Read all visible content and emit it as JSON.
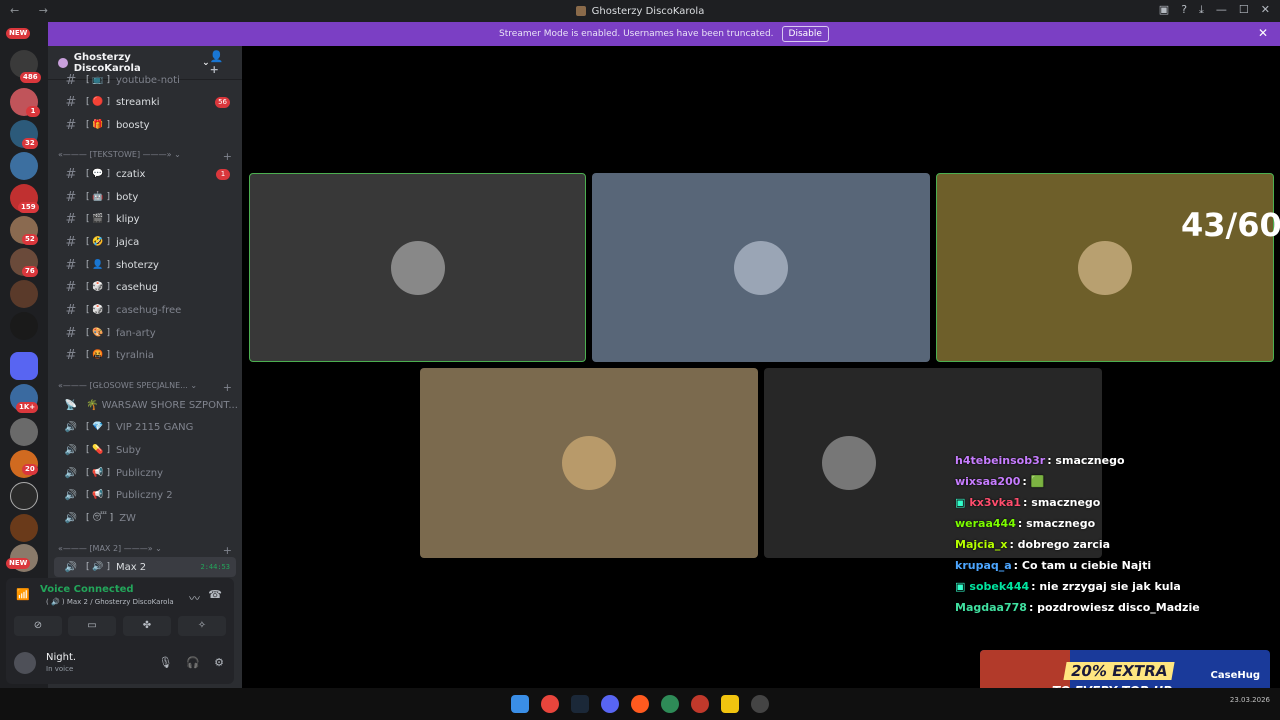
{
  "window": {
    "title": "Ghosterzy DiscoKarola"
  },
  "banner": {
    "text": "Streamer Mode is enabled. Usernames have been truncated.",
    "button": "Disable"
  },
  "guilds": {
    "new_top": "NEW",
    "new_bottom": "NEW",
    "badges": [
      "486",
      "1",
      "32",
      "159",
      "52",
      "76",
      "1K+",
      "20"
    ]
  },
  "server": {
    "name": "Ghosterzy DiscoKarola"
  },
  "channels": {
    "top": [
      {
        "name": "youtube-noti",
        "emoji": "[ 📺 ]"
      },
      {
        "name": "streamki",
        "emoji": "[ 🔴 ]",
        "badge": "56"
      },
      {
        "name": "boosty",
        "emoji": "[ 🎁 ]"
      }
    ],
    "cat_text": "«——— [TEKSTOWE] ———» ⌄",
    "text": [
      {
        "name": "czatix",
        "emoji": "[ 💬 ]",
        "badge": "1"
      },
      {
        "name": "boty",
        "emoji": "[ 🤖 ]"
      },
      {
        "name": "klipy",
        "emoji": "[ 🎬 ]"
      },
      {
        "name": "jajca",
        "emoji": "[ 🤣 ]"
      },
      {
        "name": "shoterzy",
        "emoji": "[ 👤 ]"
      },
      {
        "name": "casehug",
        "emoji": "[ 🎲 ]"
      },
      {
        "name": "casehug-free",
        "emoji": "[ 🎲 ]"
      },
      {
        "name": "fan-arty",
        "emoji": "[ 🎨 ]"
      },
      {
        "name": "tyralnia",
        "emoji": "[ 🤬 ]"
      }
    ],
    "cat_voice": "«——— [GŁOSOWE SPECJALNE... ⌄",
    "voice": [
      {
        "name": "🌴 WARSAW SHORE SZPONT...",
        "emoji": ""
      },
      {
        "name": "VIP 2115 GANG",
        "emoji": "[ 💎 ]"
      },
      {
        "name": "Suby",
        "emoji": "[ 💊 ]"
      },
      {
        "name": "Publiczny",
        "emoji": "[ 📢 ]"
      },
      {
        "name": "Publiczny 2",
        "emoji": "[ 📢 ]"
      },
      {
        "name": "ZW",
        "emoji": "[ 😴 ]"
      }
    ],
    "cat_max": "«——— [MAX 2] ———» ⌄",
    "active": {
      "name": "Max 2",
      "emoji": "[ 🔊 ]",
      "timer": "2:44:53"
    }
  },
  "voice": {
    "status": "Voice Connected",
    "sub": "( 🔊 ) Max 2 / Ghosterzy DiscoKarola"
  },
  "user": {
    "name": "Night.",
    "status": "In voice"
  },
  "counter": "43/60",
  "chat": [
    {
      "user": "h4tebeinsob3r",
      "color": "#c77dff",
      "msg": ": smacznego"
    },
    {
      "user": "wixsaa200",
      "color": "#c77dff",
      "msg": ": 🟩"
    },
    {
      "user": "kx3vka1",
      "color": "#ff4d6d",
      "msg": ": smacznego",
      "badge": true
    },
    {
      "user": "weraa444",
      "color": "#7cfc00",
      "msg": ": smacznego"
    },
    {
      "user": "Majcia_x",
      "color": "#b6ff00",
      "msg": ": dobrego zarcia"
    },
    {
      "user": "krupaq_a",
      "color": "#4da6ff",
      "msg": ": Co tam u ciebie Najti"
    },
    {
      "user": "sobek444",
      "color": "#00e5a0",
      "msg": ": nie zrzygaj sie jak kula",
      "badge": true
    },
    {
      "user": "Magdaa778",
      "color": "#40e0a0",
      "msg": ": pozdrowiesz disco_Madzie"
    }
  ],
  "ad": {
    "line1": "20% EXTRA",
    "line2": "TO EVERY TOP-UP",
    "brand": "CaseHug"
  },
  "tray": {
    "date": "23.03.2026"
  },
  "colors": {
    "accent": "#7b3fc4",
    "speaking": "#4caf50",
    "sidebar": "#2b2d31"
  }
}
